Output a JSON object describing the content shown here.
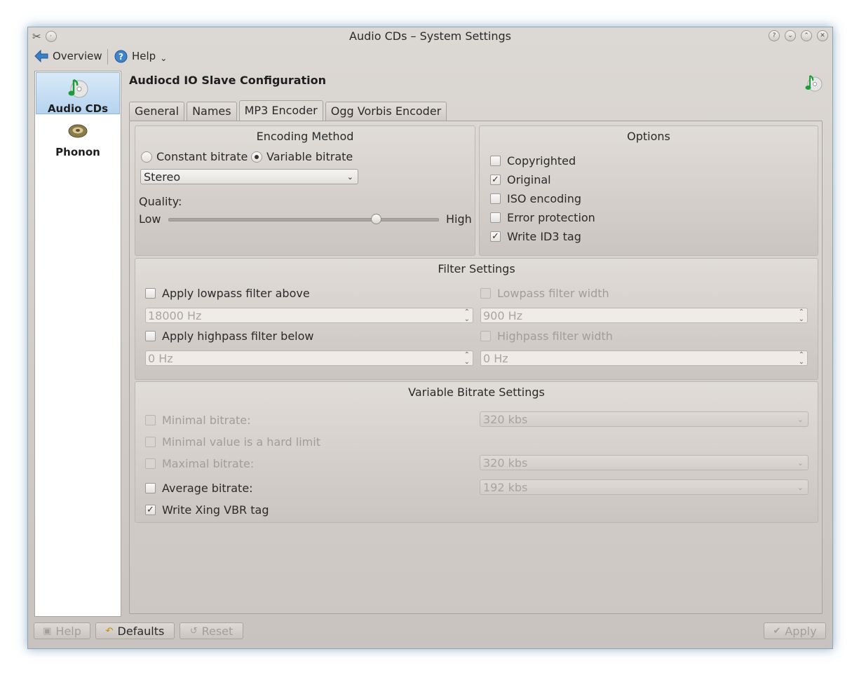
{
  "window": {
    "title": "Audio CDs – System Settings"
  },
  "toolbar": {
    "overview_label": "Overview",
    "help_label": "Help"
  },
  "sidebar": {
    "items": [
      {
        "label": "Audio CDs",
        "selected": true,
        "icon": "music-note-cd-icon"
      },
      {
        "label": "Phonon",
        "selected": false,
        "icon": "speaker-icon"
      }
    ]
  },
  "page": {
    "title": "Audiocd IO Slave Configuration"
  },
  "tabs": [
    {
      "label": "General"
    },
    {
      "label": "Names"
    },
    {
      "label": "MP3 Encoder",
      "active": true
    },
    {
      "label": "Ogg Vorbis Encoder"
    }
  ],
  "encoding": {
    "title": "Encoding Method",
    "constant_label": "Constant bitrate",
    "variable_label": "Variable bitrate",
    "selected": "Variable bitrate",
    "mode_value": "Stereo",
    "quality_label": "Quality:",
    "low_label": "Low",
    "high_label": "High",
    "quality_position": 0.77
  },
  "options": {
    "title": "Options",
    "items": [
      {
        "label": "Copyrighted",
        "checked": false
      },
      {
        "label": "Original",
        "checked": true
      },
      {
        "label": "ISO encoding",
        "checked": false
      },
      {
        "label": "Error protection",
        "checked": false
      },
      {
        "label": "Write ID3 tag",
        "checked": true
      }
    ]
  },
  "filter": {
    "title": "Filter Settings",
    "lowpass_label": "Apply lowpass filter above",
    "lowpass_value": "18000 Hz",
    "lowpass_width_label": "Lowpass filter width",
    "lowpass_width_value": "900 Hz",
    "highpass_label": "Apply highpass filter below",
    "highpass_value": "0 Hz",
    "highpass_width_label": "Highpass filter width",
    "highpass_width_value": "0 Hz"
  },
  "vbr": {
    "title": "Variable Bitrate Settings",
    "minimal_label": "Minimal bitrate:",
    "minimal_value": "320 kbs",
    "hard_limit_label": "Minimal value is a hard limit",
    "maximal_label": "Maximal bitrate:",
    "maximal_value": "320 kbs",
    "average_label": "Average bitrate:",
    "average_value": "192 kbs",
    "xing_label": "Write Xing VBR tag",
    "xing_checked": true
  },
  "buttons": {
    "help": "Help",
    "defaults": "Defaults",
    "reset": "Reset",
    "apply": "Apply"
  }
}
